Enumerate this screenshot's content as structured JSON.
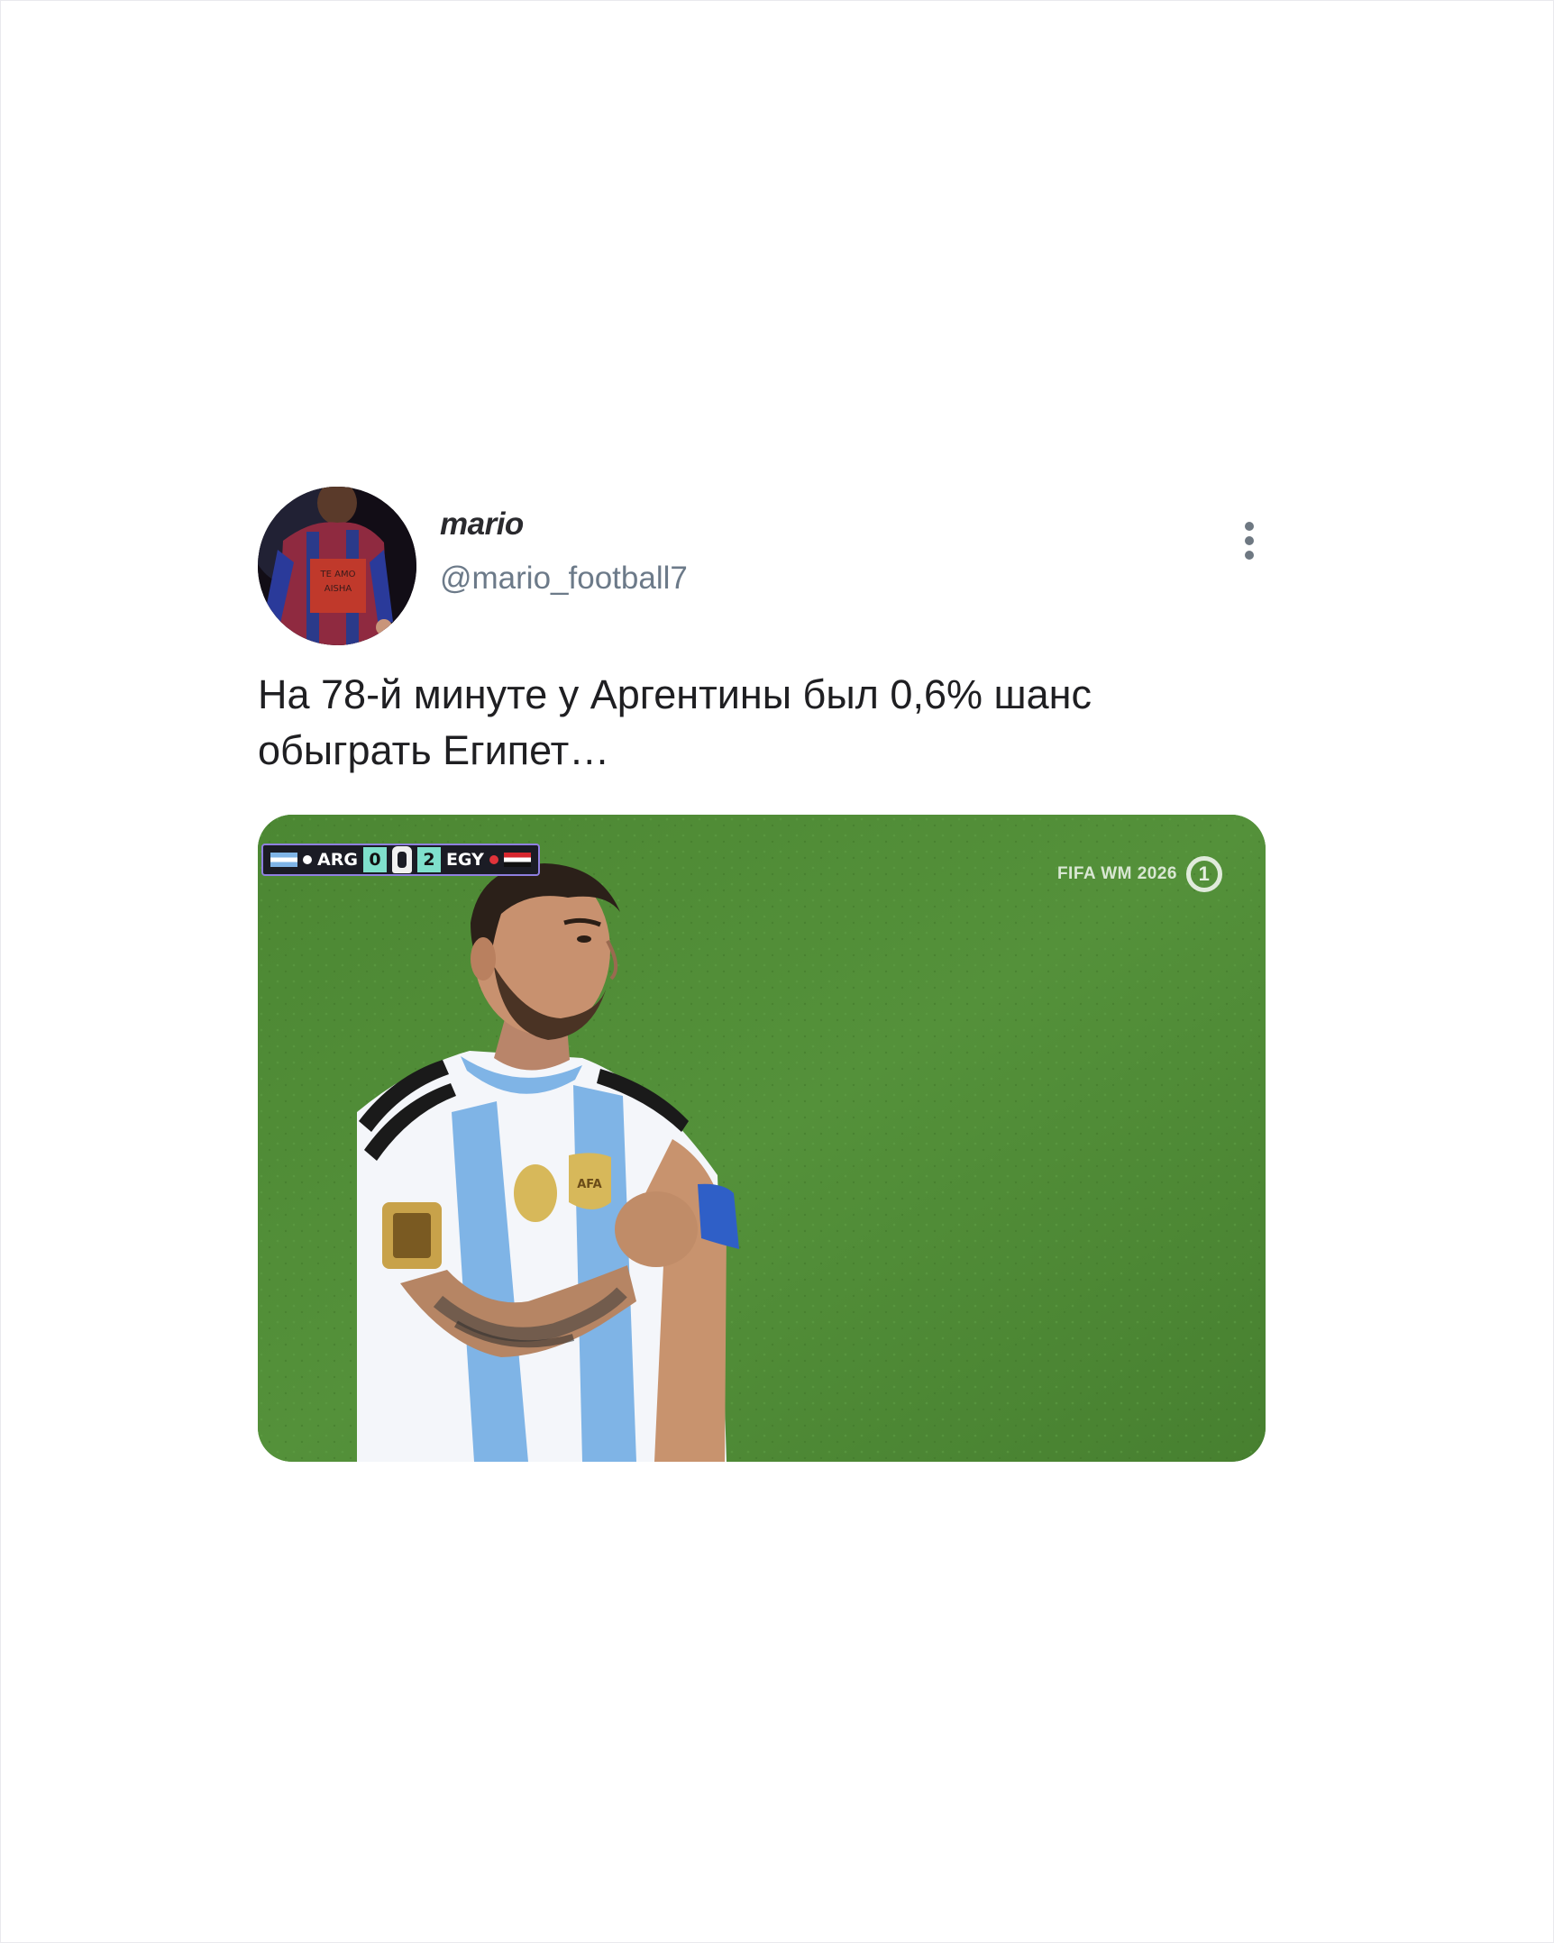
{
  "post": {
    "author": {
      "display_name": "mario",
      "handle": "@mario_football7",
      "avatar_icon": "avatar-photo"
    },
    "menu_icon": "more-vertical-icon",
    "text": "На 78-й минуте у Аргентины был 0,6% шанс обыграть Египет…",
    "media": {
      "type": "video-frame",
      "scorebug": {
        "home_team": "ARG",
        "home_score": "0",
        "away_score": "2",
        "away_team": "EGY"
      },
      "broadcaster": {
        "label": "FIFA WM 2026",
        "logo_text": "1"
      }
    }
  },
  "colors": {
    "background": "#ffffff",
    "text": "#1f1f22",
    "handle": "#6c7a89",
    "pitch": "#4f8a35",
    "scorebug_accent": "#7fe0cc"
  }
}
